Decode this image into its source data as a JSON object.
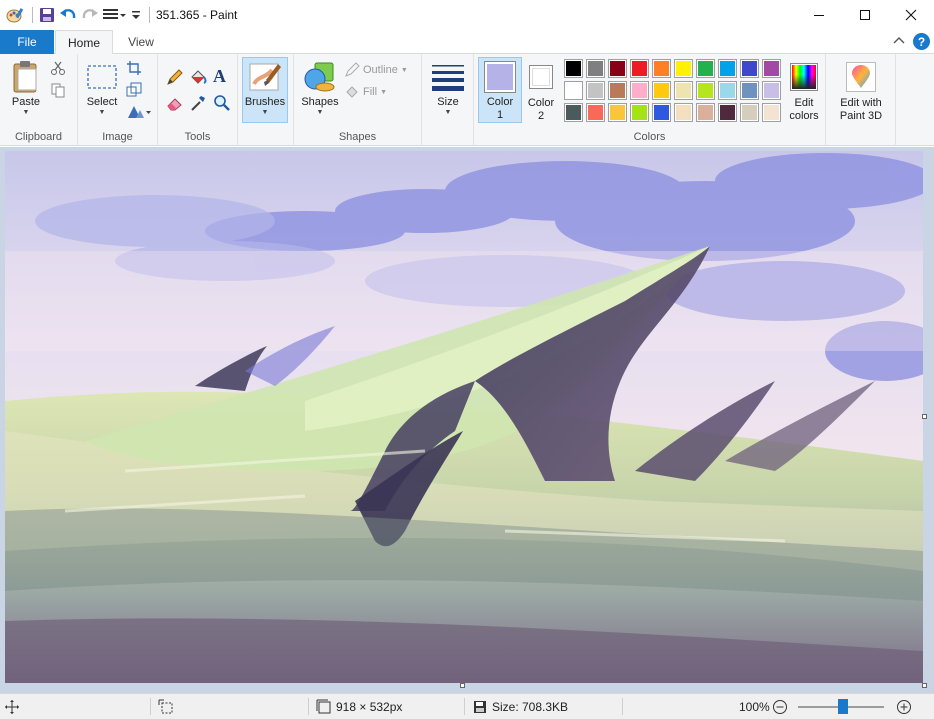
{
  "window": {
    "title": "351.365 - Paint",
    "controls": [
      "minimize",
      "maximize",
      "close"
    ]
  },
  "quick_access": {
    "icons": [
      "paint-app-icon",
      "save-icon",
      "undo-icon",
      "redo-icon",
      "customize-qa-icon"
    ]
  },
  "tabs": {
    "file": "File",
    "home": "Home",
    "view": "View",
    "active": "Home"
  },
  "ribbon": {
    "clipboard": {
      "label": "Clipboard",
      "paste": "Paste",
      "cut_icon": "scissors-icon",
      "copy_icon": "copy-icon"
    },
    "image": {
      "label": "Image",
      "select": "Select",
      "crop_icon": "crop-icon",
      "resize_icon": "resize-icon",
      "rotate_icon": "rotate-icon"
    },
    "tools": {
      "label": "Tools",
      "items": [
        "pencil-icon",
        "fill-bucket-icon",
        "text-icon",
        "eraser-icon",
        "color-picker-icon",
        "magnifier-icon"
      ]
    },
    "brushes": {
      "label": "Brushes",
      "selected": true
    },
    "shapes": {
      "label": "Shapes",
      "button": "Shapes",
      "outline": "Outline",
      "fill": "Fill"
    },
    "size": {
      "label": "Size"
    },
    "colors": {
      "label": "Colors",
      "color1_label": "Color",
      "color1_num": "1",
      "color1": "#b4b2e6",
      "color2_label": "Color",
      "color2_num": "2",
      "color2": "#ffffff",
      "edit_colors": "Edit colors",
      "edit_colors_l1": "Edit",
      "edit_colors_l2": "colors",
      "palette": [
        [
          "#000000",
          "#7f7f7f",
          "#880015",
          "#ed1c24",
          "#ff7f27",
          "#fff200",
          "#22b14c",
          "#00a2e8",
          "#3f48cc",
          "#a349a4"
        ],
        [
          "#ffffff",
          "#c3c3c3",
          "#b97a57",
          "#ffaec9",
          "#ffc90e",
          "#efe4b0",
          "#b5e61d",
          "#99d9ea",
          "#7092be",
          "#c8bfe7"
        ],
        [
          "#4b5a5a",
          "#f86a57",
          "#f9c63a",
          "#a6e21a",
          "#2f58e0",
          "#f4dfc0",
          "#d8b09c",
          "#4f2a3e",
          "#d5cdbd",
          "#f2e3d3"
        ]
      ]
    },
    "paint3d": {
      "label_l1": "Edit with",
      "label_l2": "Paint 3D"
    }
  },
  "status": {
    "dimensions": "918 × 532px",
    "size": "Size: 708.3KB",
    "zoom": "100%",
    "zoom_fraction": 0.35
  }
}
